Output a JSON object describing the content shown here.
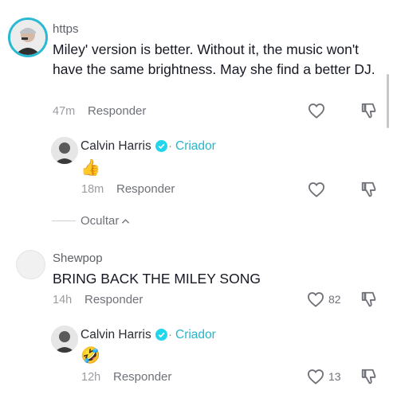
{
  "thread": {
    "comment1": {
      "username": "https",
      "text": "Miley' version is better. Without it, the music won't have the same brightness. May she find a better DJ.",
      "time": "47m",
      "reply_label": "Responder",
      "avatar_icon": "user-avatar",
      "like_icon": "heart-outline-icon",
      "dislike_icon": "thumb-down-icon"
    },
    "reply1": {
      "username": "Calvin Harris",
      "badge_icon": "verified-check-icon",
      "separator": "·",
      "creator_label": "Criador",
      "emoji": "👍",
      "time": "18m",
      "reply_label": "Responder"
    },
    "hide_label": "Ocultar",
    "hide_chevron_icon": "chevron-up-icon",
    "comment2": {
      "username": "Shewpop",
      "text": "BRING BACK THE MILEY SONG",
      "time": "14h",
      "reply_label": "Responder",
      "likes": "82"
    },
    "reply2": {
      "username": "Calvin Harris",
      "separator": "·",
      "creator_label": "Criador",
      "emoji": "🤣",
      "time": "12h",
      "reply_label": "Responder",
      "likes": "13"
    }
  },
  "colors": {
    "accent": "#26b6cc",
    "avatar_ring": "#2ab9d2",
    "text_primary": "#161823",
    "text_secondary": "#6f7178",
    "emoji_yellow": "#f7c43a"
  }
}
